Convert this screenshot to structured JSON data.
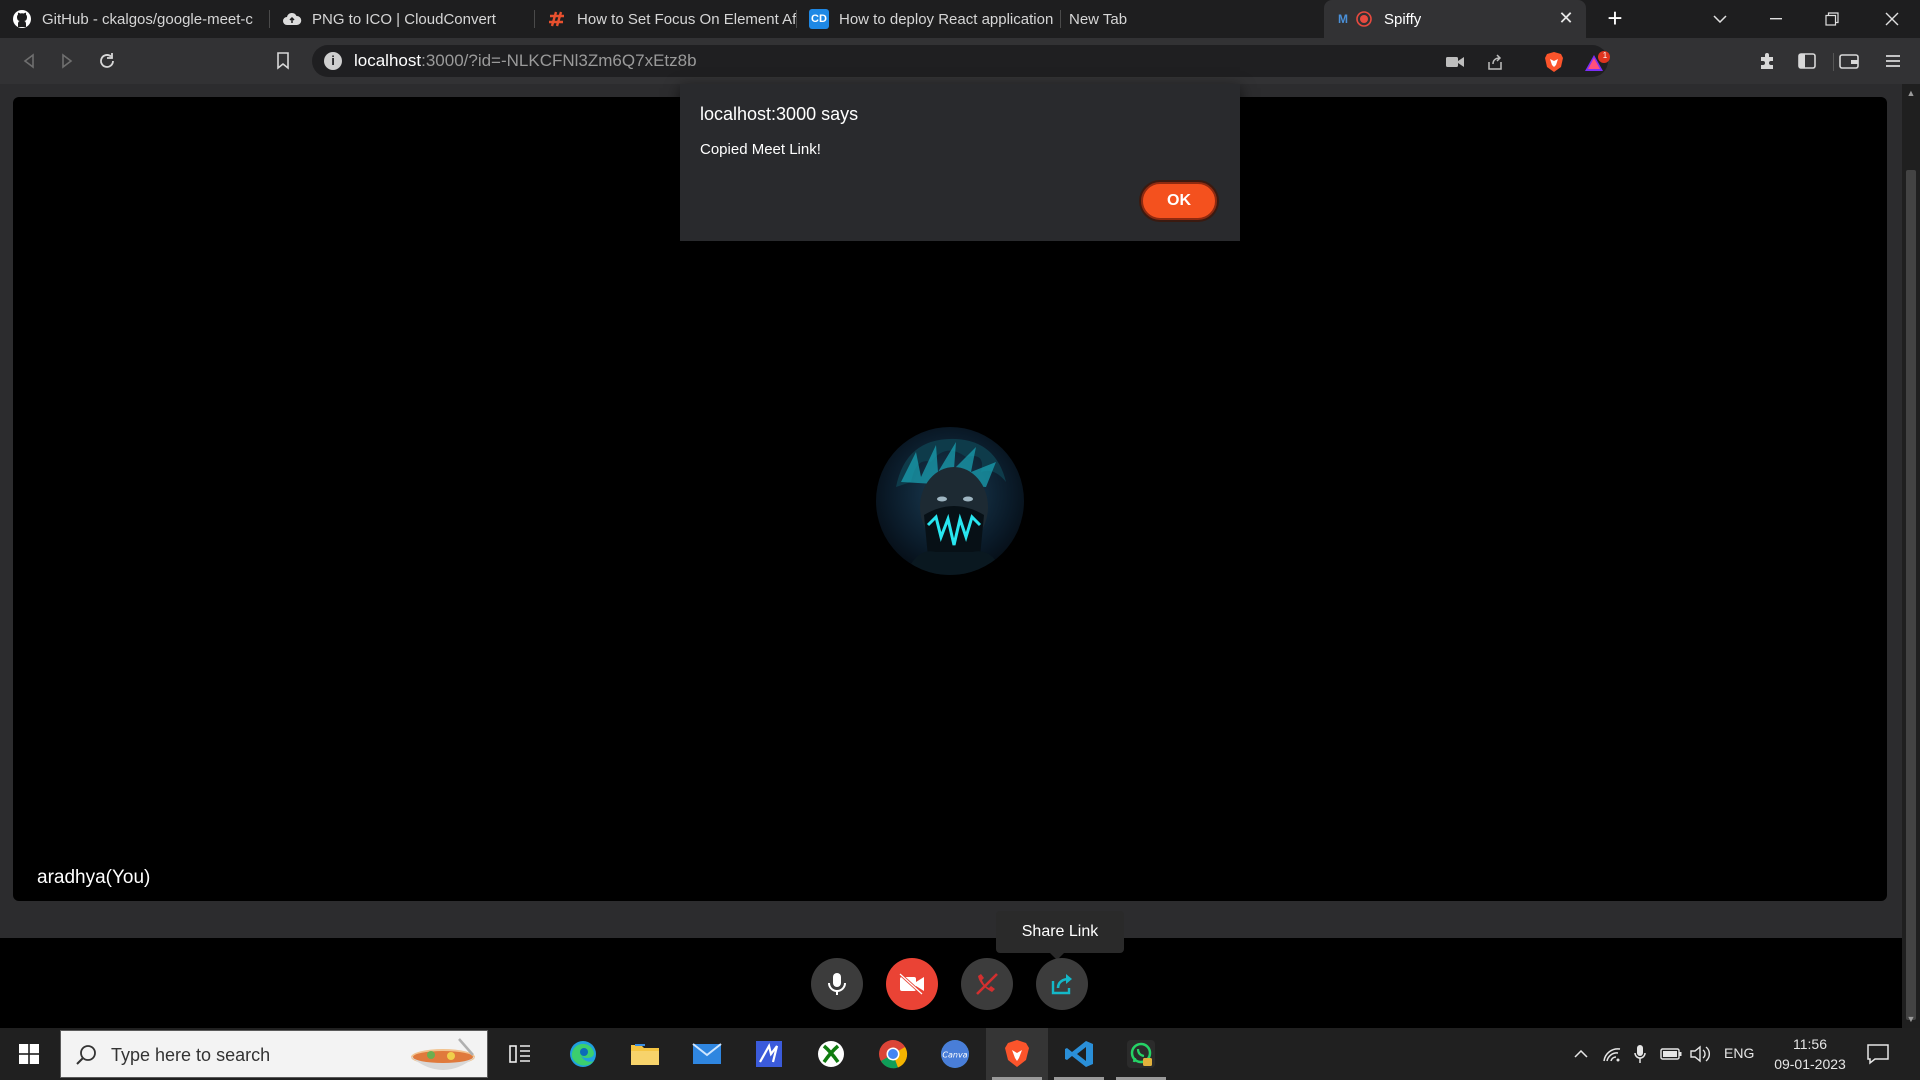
{
  "browser": {
    "tabs": [
      {
        "title": "GitHub - ckalgos/google-meet-c",
        "icon": "github-icon"
      },
      {
        "title": "PNG to ICO | CloudConvert",
        "icon": "cloudconvert-icon"
      },
      {
        "title": "How to Set Focus On Element Af",
        "icon": "hashnode-icon"
      },
      {
        "title": "How to deploy React application",
        "icon": "cd-icon",
        "icon_text": "CD"
      },
      {
        "title": "New Tab",
        "icon": ""
      },
      {
        "title": "Spiffy",
        "icon": "recording-icon",
        "active": true
      }
    ],
    "address": {
      "host": "localhost",
      "rest": ":3000/?id=-NLKCFNl3Zm6Q7xEtz8b"
    },
    "brave_badge_count": "1"
  },
  "dialog": {
    "title": "localhost:3000 says",
    "message": "Copied Meet Link!",
    "ok_label": "OK"
  },
  "meeting": {
    "participant_label": "aradhya(You)",
    "tooltip": "Share Link",
    "controls": [
      {
        "name": "mic-toggle-button",
        "icon": "microphone-icon",
        "state": "on",
        "color": "#3c3c3c"
      },
      {
        "name": "camera-toggle-button",
        "icon": "video-off-icon",
        "state": "off",
        "color": "#ea4335"
      },
      {
        "name": "leave-call-button",
        "icon": "phone-hangup-icon",
        "color": "#3c3c3c"
      },
      {
        "name": "share-link-button",
        "icon": "share-icon",
        "color": "#3c3c3c"
      }
    ]
  },
  "taskbar": {
    "search_placeholder": "Type here to search",
    "apps": [
      "task-view",
      "edge",
      "file-explorer",
      "mail",
      "marker",
      "xbox",
      "chrome",
      "canva",
      "brave",
      "vscode",
      "whatsapp"
    ],
    "language": "ENG",
    "time": "11:56",
    "date": "09-01-2023"
  },
  "colors": {
    "accent": "#f4511e",
    "brave_orange": "#fb542b",
    "camera_off": "#ea4335"
  }
}
